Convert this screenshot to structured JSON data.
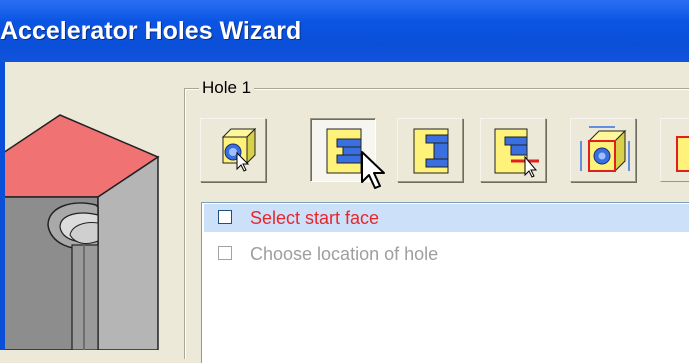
{
  "window": {
    "title": "Accelerator Holes Wizard"
  },
  "group": {
    "label": "Hole 1"
  },
  "toolbar": {
    "buttons": [
      {
        "icon": "hole-on-face-icon",
        "pressed": false
      },
      {
        "icon": "counterbore-hole-icon",
        "pressed": true
      },
      {
        "icon": "stepped-hole-icon",
        "pressed": false
      },
      {
        "icon": "hole-depth-icon",
        "pressed": false
      },
      {
        "icon": "hole-position-icon",
        "pressed": false
      }
    ]
  },
  "steps": [
    {
      "label": "Select start face",
      "checked": false,
      "state": "active"
    },
    {
      "label": "Choose location of hole",
      "checked": false,
      "state": "disabled"
    }
  ],
  "colors": {
    "titlebar": "#0a4fd8",
    "active_step_text": "#e8262a",
    "selection_background": "#cce0fa",
    "part_face_red": "#f07070",
    "part_gray": "#8a8a8a",
    "icon_yellow": "#fff27a",
    "icon_blue": "#3a6fe0"
  }
}
